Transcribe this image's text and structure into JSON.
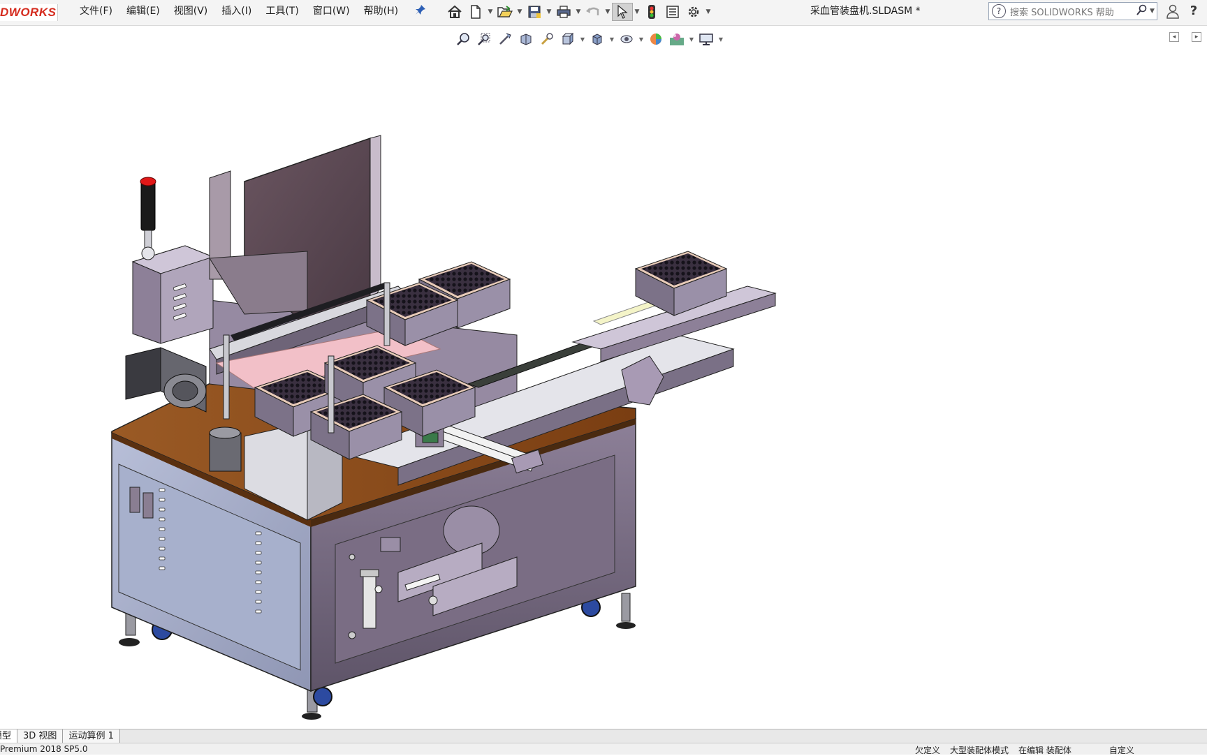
{
  "app": {
    "logo_text": "DWORKS",
    "document_title": "采血管装盘机.SLDASM *"
  },
  "menu": {
    "items": [
      "文件(F)",
      "编辑(E)",
      "视图(V)",
      "插入(I)",
      "工具(T)",
      "窗口(W)",
      "帮助(H)"
    ]
  },
  "search": {
    "placeholder": "搜索 SOLIDWORKS 帮助"
  },
  "tabs": [
    "模型",
    "3D 视图",
    "运动算例 1"
  ],
  "status": {
    "version": "Premium 2018 SP5.0",
    "items": [
      "欠定义",
      "大型装配体模式",
      "在编辑 装配体",
      "自定义"
    ]
  },
  "colors": {
    "brand_red": "#d52b1e",
    "machine_body": "#8a7e92",
    "table_top": "#8a4a1a",
    "panel_blue": "#aab3cc"
  },
  "icons": [
    "home-icon",
    "new-doc-icon",
    "open-icon",
    "save-icon",
    "print-icon",
    "undo-icon",
    "select-icon",
    "traffic-light-icon",
    "file-props-icon",
    "options-icon",
    "zoom-fit-icon",
    "zoom-area-icon",
    "previous-view-icon",
    "section-view-icon",
    "dynamic-annot-icon",
    "view-orientation-icon",
    "display-style-icon",
    "hide-show-icon",
    "appearance-icon",
    "scene-icon",
    "view-settings-icon"
  ]
}
